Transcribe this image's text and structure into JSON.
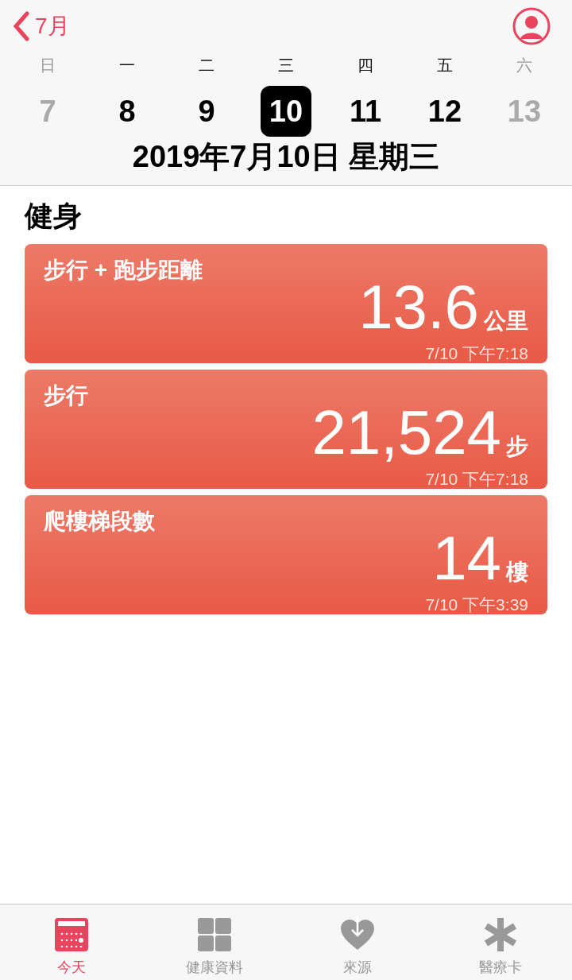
{
  "nav": {
    "back_label": "7月"
  },
  "week": {
    "weekdays": [
      {
        "label": "日",
        "weekend": true
      },
      {
        "label": "一",
        "weekend": false
      },
      {
        "label": "二",
        "weekend": false
      },
      {
        "label": "三",
        "weekend": false
      },
      {
        "label": "四",
        "weekend": false
      },
      {
        "label": "五",
        "weekend": false
      },
      {
        "label": "六",
        "weekend": true
      }
    ],
    "days": [
      {
        "label": "7",
        "weekend": true,
        "selected": false
      },
      {
        "label": "8",
        "weekend": false,
        "selected": false
      },
      {
        "label": "9",
        "weekend": false,
        "selected": false
      },
      {
        "label": "10",
        "weekend": false,
        "selected": true
      },
      {
        "label": "11",
        "weekend": false,
        "selected": false
      },
      {
        "label": "12",
        "weekend": false,
        "selected": false
      },
      {
        "label": "13",
        "weekend": true,
        "selected": false
      }
    ],
    "full_date": "2019年7月10日 星期三"
  },
  "section": {
    "title": "健身"
  },
  "cards": [
    {
      "title": "步行 + 跑步距離",
      "value": "13.6",
      "unit": "公里",
      "time": "7/10 下午7:18"
    },
    {
      "title": "步行",
      "value": "21,524",
      "unit": "步",
      "time": "7/10 下午7:18"
    },
    {
      "title": "爬樓梯段數",
      "value": "14",
      "unit": "樓",
      "time": "7/10 下午3:39"
    }
  ],
  "tab_bar": [
    {
      "kind": "today",
      "label": "今天",
      "selected": true
    },
    {
      "kind": "data",
      "label": "健康資料",
      "selected": false
    },
    {
      "kind": "sources",
      "label": "來源",
      "selected": false
    },
    {
      "kind": "medical",
      "label": "醫療卡",
      "selected": false
    }
  ]
}
